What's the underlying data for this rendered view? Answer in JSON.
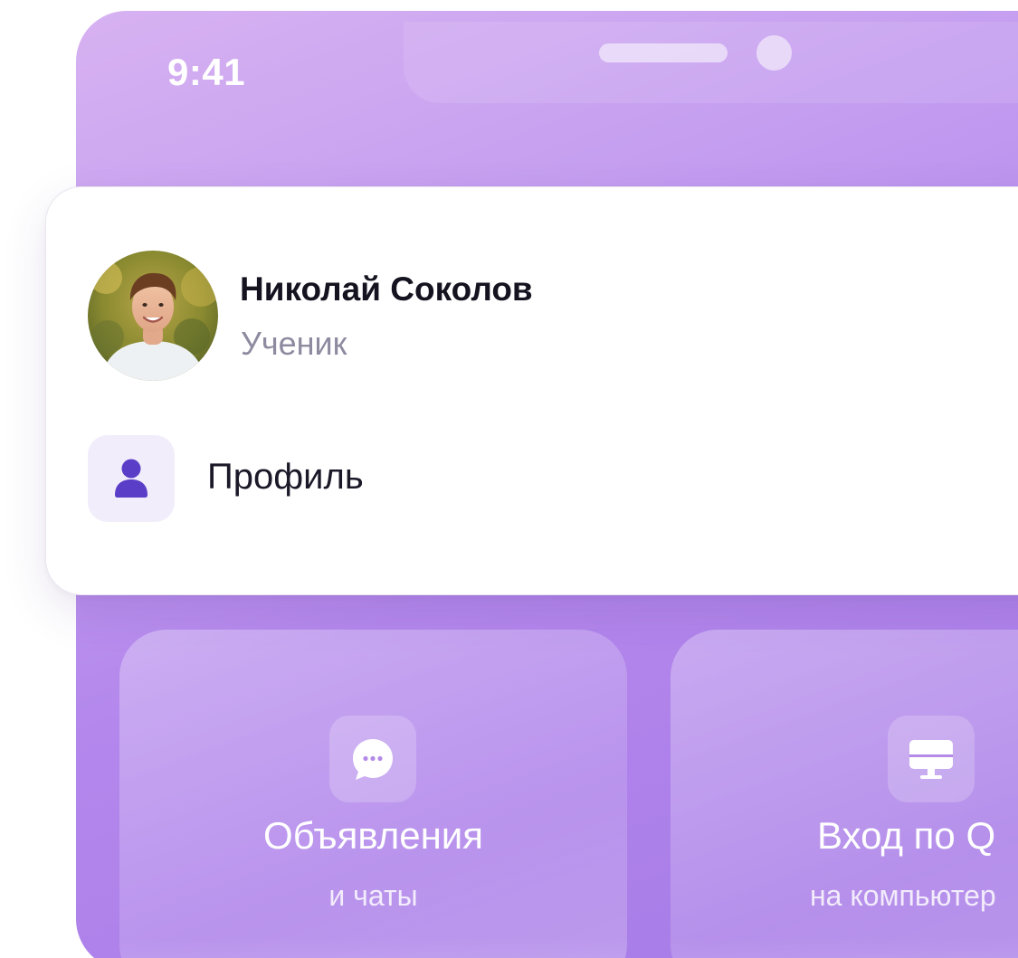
{
  "status_bar": {
    "time": "9:41"
  },
  "profile": {
    "name": "Николай Соколов",
    "role": "Ученик",
    "avatar_icon": "user-photo"
  },
  "menu": {
    "items": [
      {
        "label": "Профиль",
        "icon": "person-icon"
      }
    ]
  },
  "tiles": [
    {
      "title": "Объявления",
      "subtitle": "и чаты",
      "icon": "chat-bubble-icon"
    },
    {
      "title": "Вход по Q",
      "subtitle": "на компьютер",
      "icon": "monitor-icon"
    }
  ],
  "colors": {
    "accent": "#5b3ec8",
    "background_top": "#d7b2f1",
    "background_bottom": "#a67ae6",
    "card": "#ffffff",
    "name_text": "#15131f",
    "role_text": "#8e8aa0"
  }
}
